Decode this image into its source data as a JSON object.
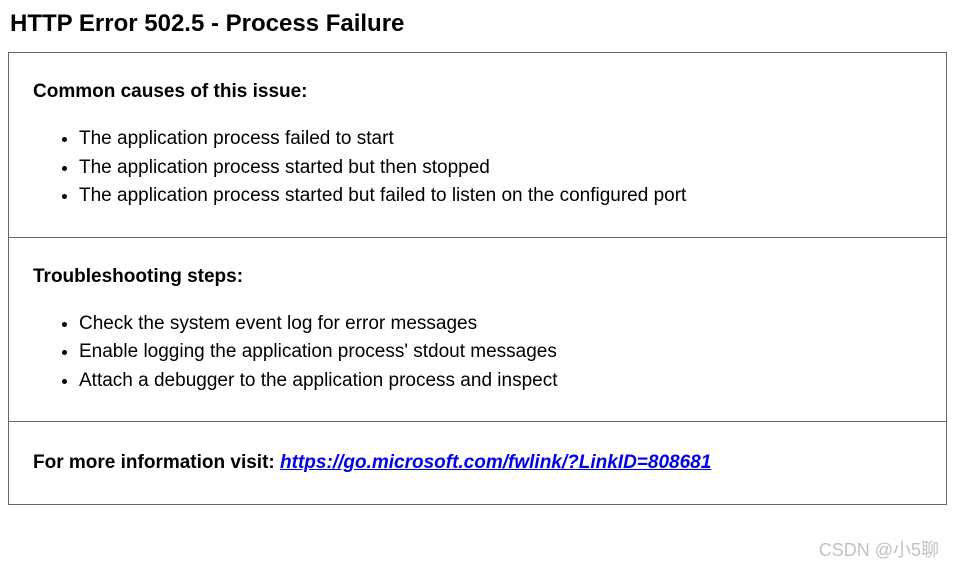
{
  "title": "HTTP Error 502.5 - Process Failure",
  "causes": {
    "heading": "Common causes of this issue:",
    "items": [
      "The application process failed to start",
      "The application process started but then stopped",
      "The application process started but failed to listen on the configured port"
    ]
  },
  "troubleshooting": {
    "heading": "Troubleshooting steps:",
    "items": [
      "Check the system event log for error messages",
      "Enable logging the application process' stdout messages",
      "Attach a debugger to the application process and inspect"
    ]
  },
  "info": {
    "label": "For more information visit: ",
    "link_text": "https://go.microsoft.com/fwlink/?LinkID=808681",
    "link_href": "https://go.microsoft.com/fwlink/?LinkID=808681"
  },
  "watermark": "CSDN @小5聊"
}
